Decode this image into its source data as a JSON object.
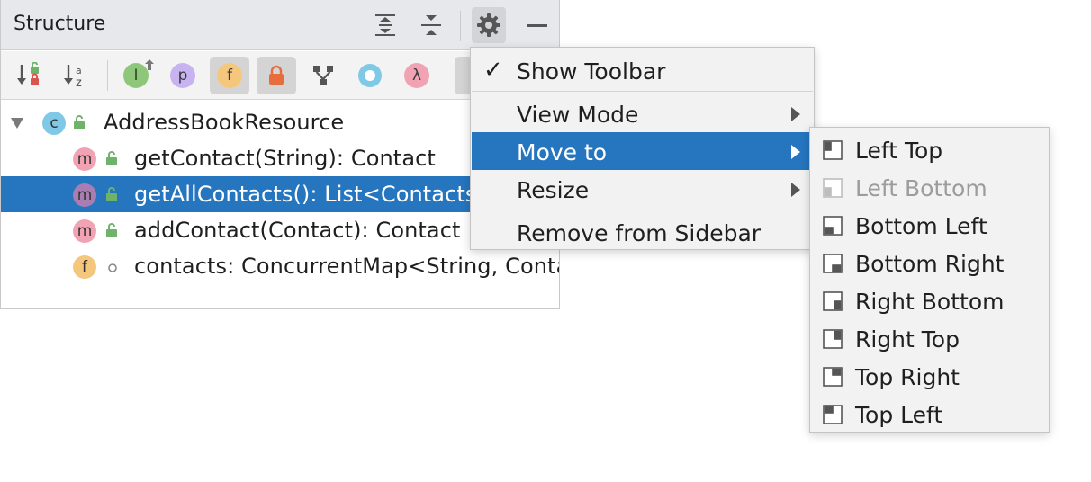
{
  "panel": {
    "title": "Structure",
    "title_icons": [
      "expand-all-icon",
      "collapse-all-icon",
      "gear-icon",
      "hide-icon"
    ],
    "toolbar_icons": [
      "sort-by-visibility-icon",
      "sort-alphabetically-icon",
      "show-inherited-icon",
      "show-properties-icon",
      "show-fields-icon",
      "show-non-public-icon",
      "show-hierarchy-icon",
      "show-anonymous-icon",
      "show-lambdas-icon"
    ],
    "tool_glyphs": {
      "p": "p",
      "f": "f",
      "lambda": "λ",
      "interface": "I"
    }
  },
  "tree": {
    "root": {
      "badge": "c",
      "label": "AddressBookResource"
    },
    "items": [
      {
        "badge": "m",
        "label": "getContact(String): Contact",
        "selected": false
      },
      {
        "badge": "m",
        "label": "getAllContacts(): List<Contacts>",
        "selected": true
      },
      {
        "badge": "m",
        "label": "addContact(Contact): Contact",
        "selected": false
      },
      {
        "badge": "f",
        "label": "contacts: ConcurrentMap<String, Contact>",
        "selected": false
      }
    ]
  },
  "menu": {
    "check_glyph": "✓",
    "items": [
      {
        "label": "Show Toolbar",
        "checked": true
      },
      {
        "label": "View Mode",
        "submenu": true
      },
      {
        "label": "Move to",
        "submenu": true,
        "active": true
      },
      {
        "label": "Resize",
        "submenu": true
      },
      {
        "label": "Remove from Sidebar"
      }
    ]
  },
  "submenu": {
    "items": [
      {
        "label": "Left Top",
        "icon": "left-top-icon"
      },
      {
        "label": "Left Bottom",
        "icon": "left-bottom-icon",
        "disabled": true
      },
      {
        "label": "Bottom Left",
        "icon": "bottom-left-icon"
      },
      {
        "label": "Bottom Right",
        "icon": "bottom-right-icon"
      },
      {
        "label": "Right Bottom",
        "icon": "right-bottom-icon"
      },
      {
        "label": "Right Top",
        "icon": "right-top-icon"
      },
      {
        "label": "Top Right",
        "icon": "top-right-icon"
      },
      {
        "label": "Top Left",
        "icon": "top-left-icon"
      }
    ]
  },
  "colors": {
    "selection": "#2675bf",
    "method_badge": "#f2a3b3",
    "method_badge_selected": "#a87eb2",
    "field_badge": "#f4c77d",
    "class_badge": "#7fc9e6",
    "lock_green": "#6fb36b"
  }
}
